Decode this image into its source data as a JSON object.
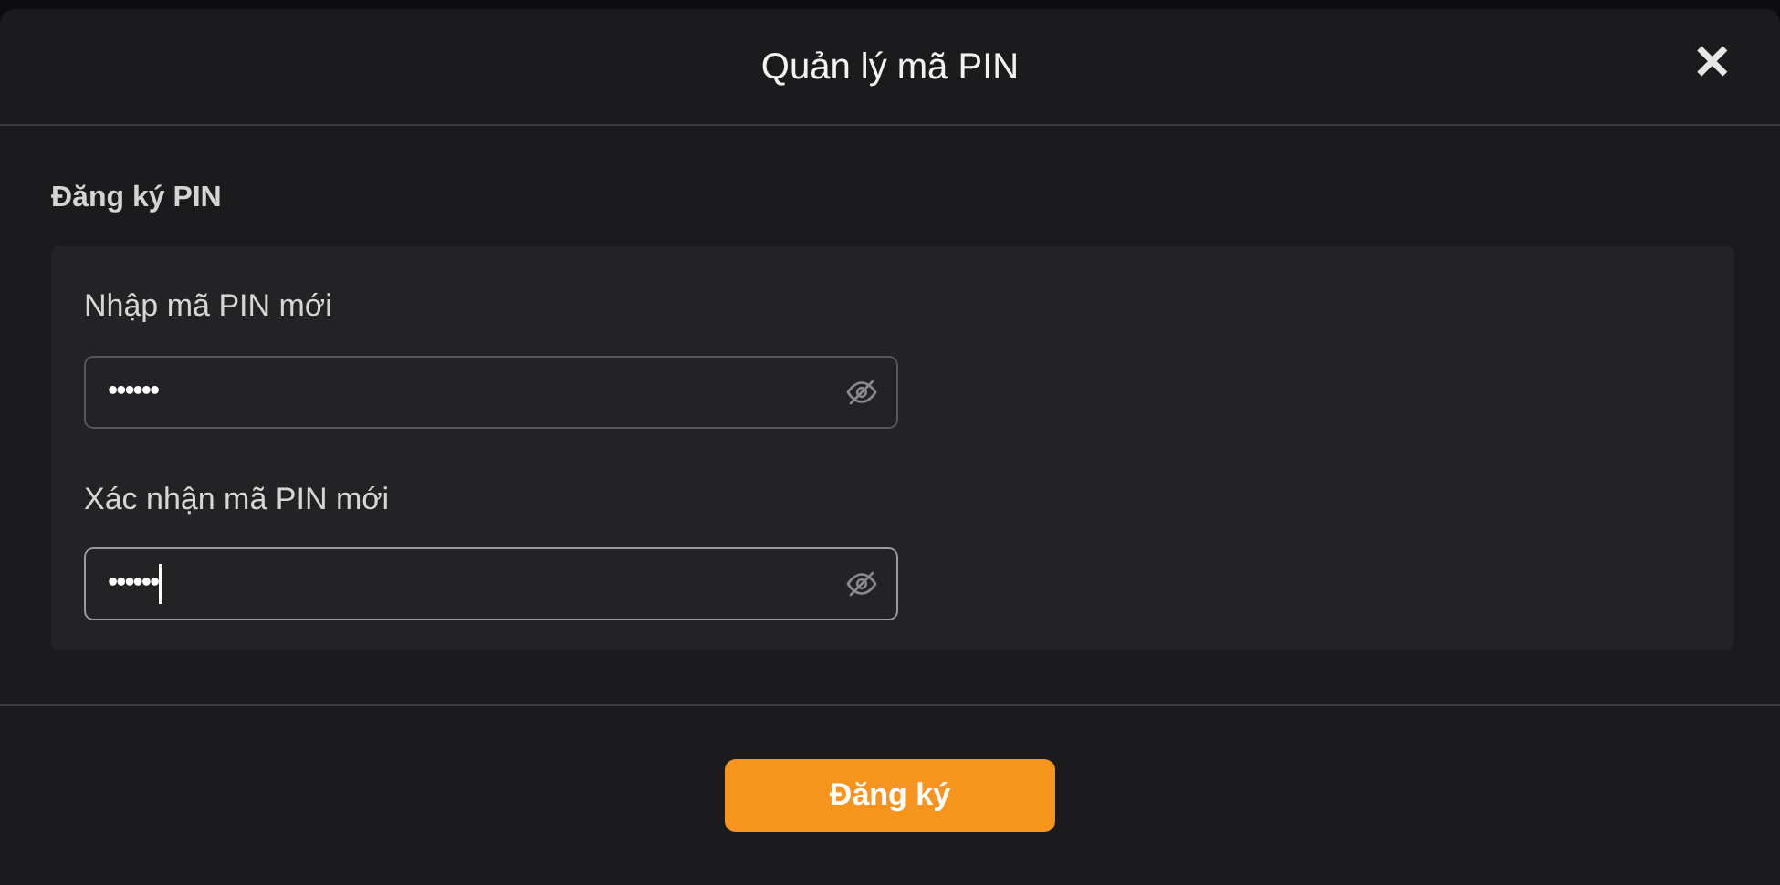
{
  "dialog": {
    "title": "Quản lý mã PIN",
    "close_icon": "✕"
  },
  "section": {
    "title": "Đăng ký PIN"
  },
  "fields": [
    {
      "label": "Nhập mã PIN mới",
      "value": "••••••",
      "focused": false
    },
    {
      "label": "Xác nhận mã PIN mới",
      "value": "••••••",
      "focused": true
    }
  ],
  "submit_button": {
    "label": "Đăng ký"
  }
}
